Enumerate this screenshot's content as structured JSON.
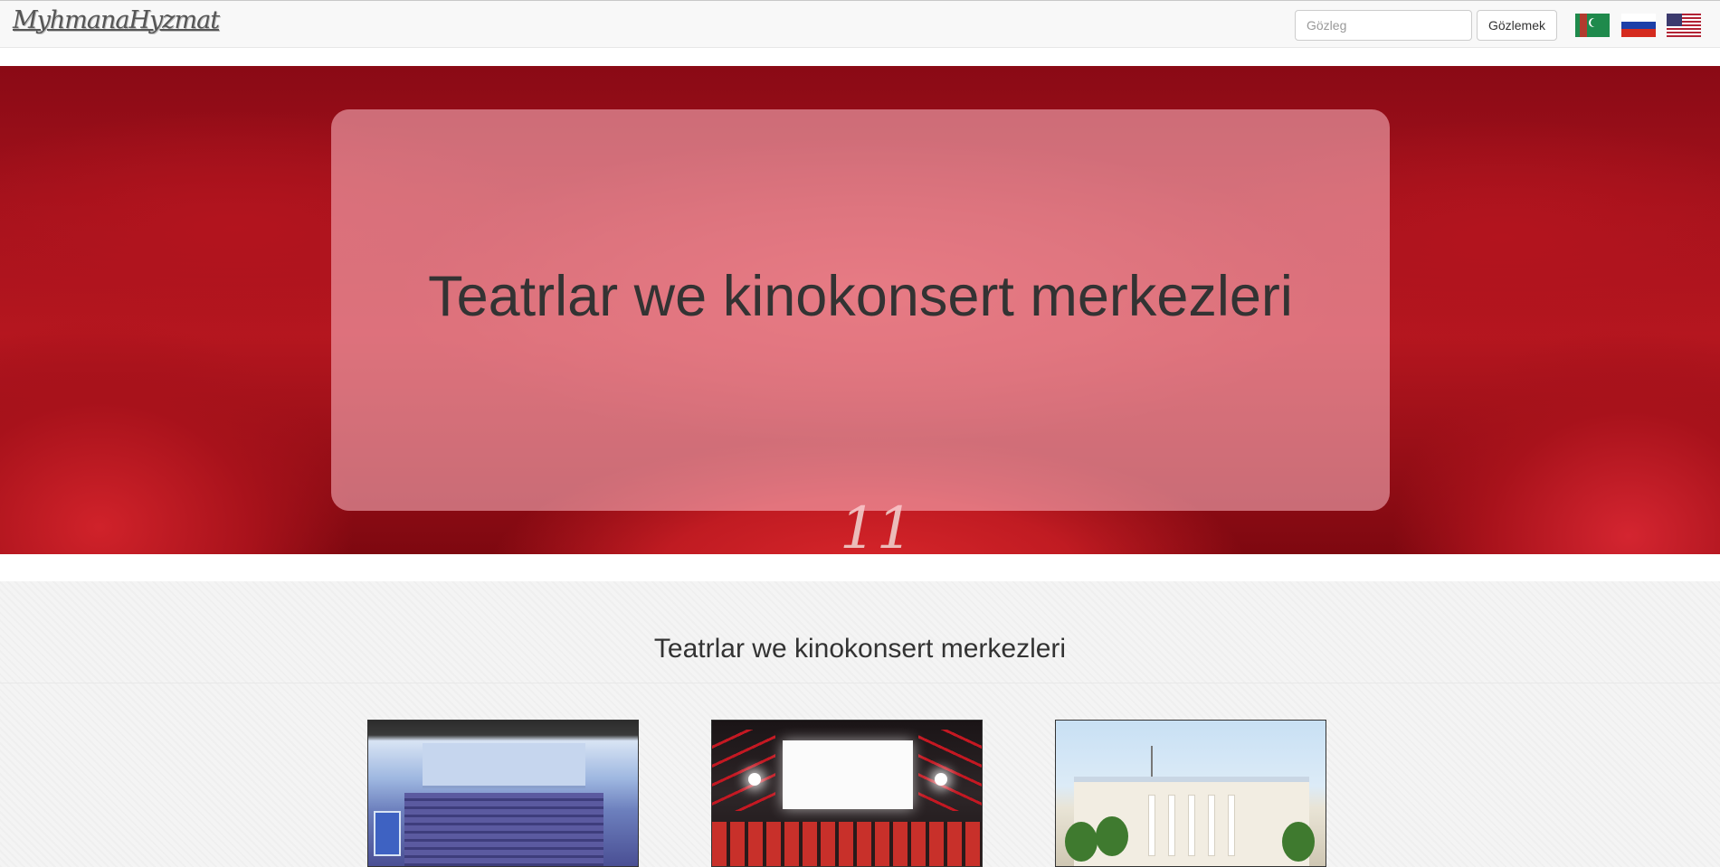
{
  "header": {
    "brand": "MyhmanaHyzmat",
    "search": {
      "placeholder": "Gözleg",
      "value": ""
    },
    "search_button": "Gözlemek",
    "languages": [
      {
        "name": "Turkmen",
        "icon": "turkmenistan-flag-icon"
      },
      {
        "name": "Russian",
        "icon": "russia-flag-icon"
      },
      {
        "name": "English",
        "icon": "usa-flag-icon"
      }
    ]
  },
  "hero": {
    "title": "Teatrlar we kinokonsert merkezleri"
  },
  "section": {
    "title": "Teatrlar we kinokonsert merkezleri",
    "cards": [
      {
        "image": "theater-hall-image"
      },
      {
        "image": "cinema-screen-image"
      },
      {
        "image": "concert-building-image"
      }
    ]
  },
  "colors": {
    "navbar_bg": "#f8f8f8",
    "hero_overlay": "#ffbec8",
    "section_bg": "#f4f4f4",
    "text": "#333333"
  }
}
